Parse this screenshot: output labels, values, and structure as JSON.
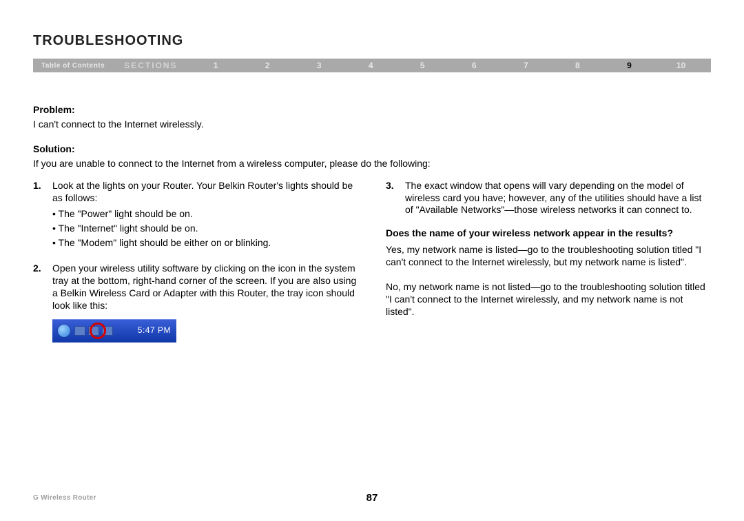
{
  "title": "TROUBLESHOOTING",
  "nav": {
    "toc": "Table of Contents",
    "sections_label": "SECTIONS",
    "numbers": [
      "1",
      "2",
      "3",
      "4",
      "5",
      "6",
      "7",
      "8",
      "9",
      "10"
    ],
    "active_index": 8
  },
  "problem": {
    "label": "Problem:",
    "text": "I can't connect to the Internet wirelessly."
  },
  "solution": {
    "label": "Solution:",
    "intro": "If you are unable to connect to the Internet from a wireless computer, please do the following:"
  },
  "left_steps": [
    {
      "num": "1.",
      "text": "Look at the lights on your Router. Your Belkin Router's lights should be as follows:",
      "bullets": [
        "The \"Power\" light should be on.",
        "The \"Internet\" light should be on.",
        "The \"Modem\" light should be either on or blinking."
      ]
    },
    {
      "num": "2.",
      "text": "Open your wireless utility software by clicking on the icon in the system tray at the bottom, right-hand corner of the screen. If you are also using a Belkin Wireless Card or Adapter with this Router, the tray icon should look like this:"
    }
  ],
  "tray_time": "5:47 PM",
  "right_steps": [
    {
      "num": "3.",
      "text": "The exact window that opens will vary depending on the model of wireless card you have; however, any of the utilities should have a list of \"Available Networks\"—those wireless networks it can connect to."
    }
  ],
  "question": "Does the name of your wireless network appear in the results?",
  "answer_yes": "Yes, my network name is listed—go to the troubleshooting solution titled \"I can't connect to the Internet wirelessly, but my network name is listed\".",
  "answer_no": "No, my network name is not listed—go to the troubleshooting solution titled \"I can't connect to the Internet wirelessly, and my network name is not listed\".",
  "footer": {
    "left": "G Wireless Router",
    "page": "87"
  }
}
